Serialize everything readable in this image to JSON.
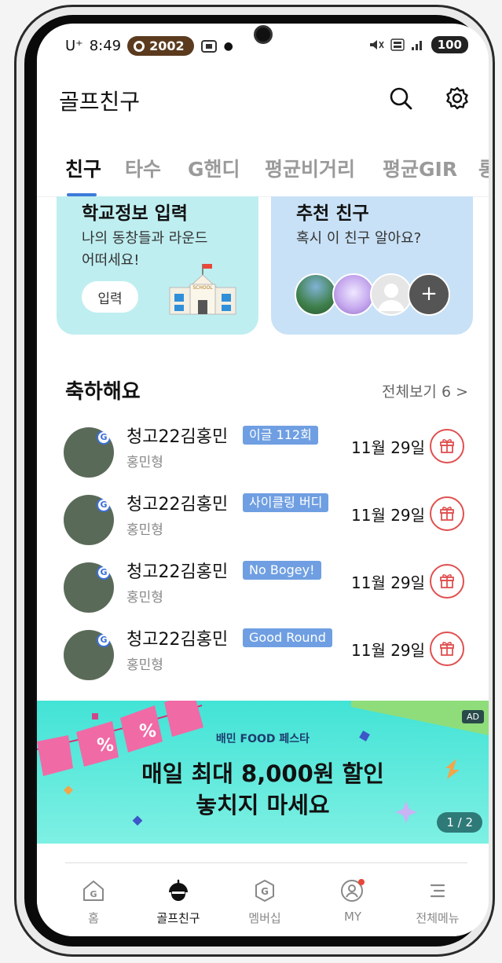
{
  "status_bar": {
    "carrier": "U⁺",
    "time": "8:49",
    "badge_value": "2002",
    "battery": "100"
  },
  "app": {
    "title": "골프친구"
  },
  "tabs": [
    {
      "label": "친구",
      "active": true
    },
    {
      "label": "타수",
      "active": false
    },
    {
      "label": "G핸디",
      "active": false
    },
    {
      "label": "평균비거리",
      "active": false
    },
    {
      "label": "평균GIR",
      "active": false
    },
    {
      "label": "롱",
      "active": false
    }
  ],
  "cards": {
    "school": {
      "title": "학교정보 입력",
      "desc_line1": "나의 동창들과 라운드",
      "desc_line2": "어떠세요!",
      "button": "입력",
      "icon": "school-building-icon",
      "icon_text": "SCHOOL"
    },
    "recommend": {
      "title": "추천 친구",
      "desc": "혹시 이 친구 알아요?",
      "add": "+"
    }
  },
  "celebrate": {
    "title": "축하해요",
    "see_all": "전체보기 6 >",
    "items": [
      {
        "name": "청고22김홍민",
        "tag": "이글 112회",
        "sub": "홍민형",
        "date": "11월 29일"
      },
      {
        "name": "청고22김홍민",
        "tag": "사이클링 버디",
        "sub": "홍민형",
        "date": "11월 29일"
      },
      {
        "name": "청고22김홍민",
        "tag": "No Bogey!",
        "sub": "홍민형",
        "date": "11월 29일"
      },
      {
        "name": "청고22김홍민",
        "tag": "Good Round",
        "sub": "홍민형",
        "date": "11월 29일"
      }
    ]
  },
  "banner": {
    "ad": "AD",
    "brand": "배민 FOOD 페스타",
    "line1": "매일 최대 8,000원 할인",
    "line2": "놓치지 마세요",
    "page": "1 / 2",
    "flag_text": "%"
  },
  "bottom_nav": [
    {
      "label": "홈",
      "icon": "home-g-icon",
      "active": false
    },
    {
      "label": "골프친구",
      "icon": "golf-friend-icon",
      "active": true
    },
    {
      "label": "멤버십",
      "icon": "membership-g-icon",
      "active": false
    },
    {
      "label": "MY",
      "icon": "my-profile-icon",
      "active": false
    },
    {
      "label": "전체메뉴",
      "icon": "menu-icon",
      "active": false
    }
  ],
  "colors": {
    "accent": "#3b7cd8",
    "tag": "#6f9fe2",
    "gift": "#e05050",
    "school_card": "#bfeef0",
    "friend_card": "#c8e1f6",
    "banner": "#42e3d6"
  }
}
